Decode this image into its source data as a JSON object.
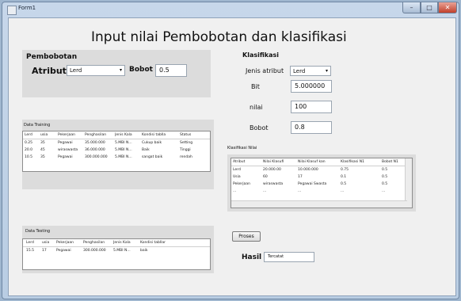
{
  "window": {
    "title": "Form1",
    "minimize": "–",
    "maximize": "□",
    "close": "✕"
  },
  "heading": "Input nilai Pembobotan dan klasifikasi",
  "pembobotan": {
    "title": "Pembobotan",
    "atribut_label": "Atribut",
    "atribut_value": "Lerd",
    "bobot_label": "Bobot",
    "bobot_value": "0.5"
  },
  "klasifikasi": {
    "title": "Klasifikasi",
    "jenis_label": "Jenis atribut",
    "jenis_value": "Lerd",
    "batas_label": "Bit",
    "batas_value": "5.000000",
    "nilai_label": "nilai",
    "nilai_value": "100",
    "bobot_label": "Bobot",
    "bobot_value": "0.8"
  },
  "data_training": {
    "label": "Data Training",
    "columns": [
      "Lerd",
      "usia",
      "Pekerjaan",
      "Penghasilan",
      "Jenis Kala",
      "Kondisi tabllar",
      "Status"
    ],
    "rows": [
      [
        "0.25",
        "35",
        "Pegawai",
        "35.000.000",
        "5.MBI N...",
        "Cukup baik",
        "Setting"
      ],
      [
        "20.0",
        "45",
        "wiraswasta",
        "36.000.000",
        "5.MBI N...",
        "Baik",
        "Tinggi"
      ],
      [
        "10.5",
        "35",
        "Pegawai",
        "300.000.000",
        "5.MBI N...",
        "sangat baik",
        "rendah"
      ]
    ]
  },
  "data_testing": {
    "label": "Data Testing",
    "columns": [
      "Lerd",
      "usia",
      "Pekerjaan",
      "Penghasilan",
      "Jenis Kala",
      "Kondisi tabllar"
    ],
    "rows": [
      [
        "15.5",
        "17",
        "Pegawai",
        "300.000.000",
        "5.MBI N...",
        "baik"
      ]
    ]
  },
  "nilai_klasifikasi": {
    "label": "Klasifikasi Nilai",
    "columns": [
      "Atribut",
      "Nilai Klasufi",
      "Nilai Klasuf kan",
      "Klasifikasi N1",
      "Bobot N1"
    ],
    "rows": [
      [
        "Lerd",
        "20.000.00",
        "10.000.000",
        "0.75",
        "0.5"
      ],
      [
        "Usia",
        "60",
        "17",
        "0.1",
        "0.5"
      ],
      [
        "Pekerjaan",
        "wiraswasta",
        "Pegawai Swasta",
        "0.5",
        "0.5"
      ],
      [
        "...",
        "...",
        "...",
        "...",
        "..."
      ]
    ]
  },
  "proses_button": "Proses",
  "hasil": {
    "label": "Hasil",
    "value": "Tercatat"
  }
}
